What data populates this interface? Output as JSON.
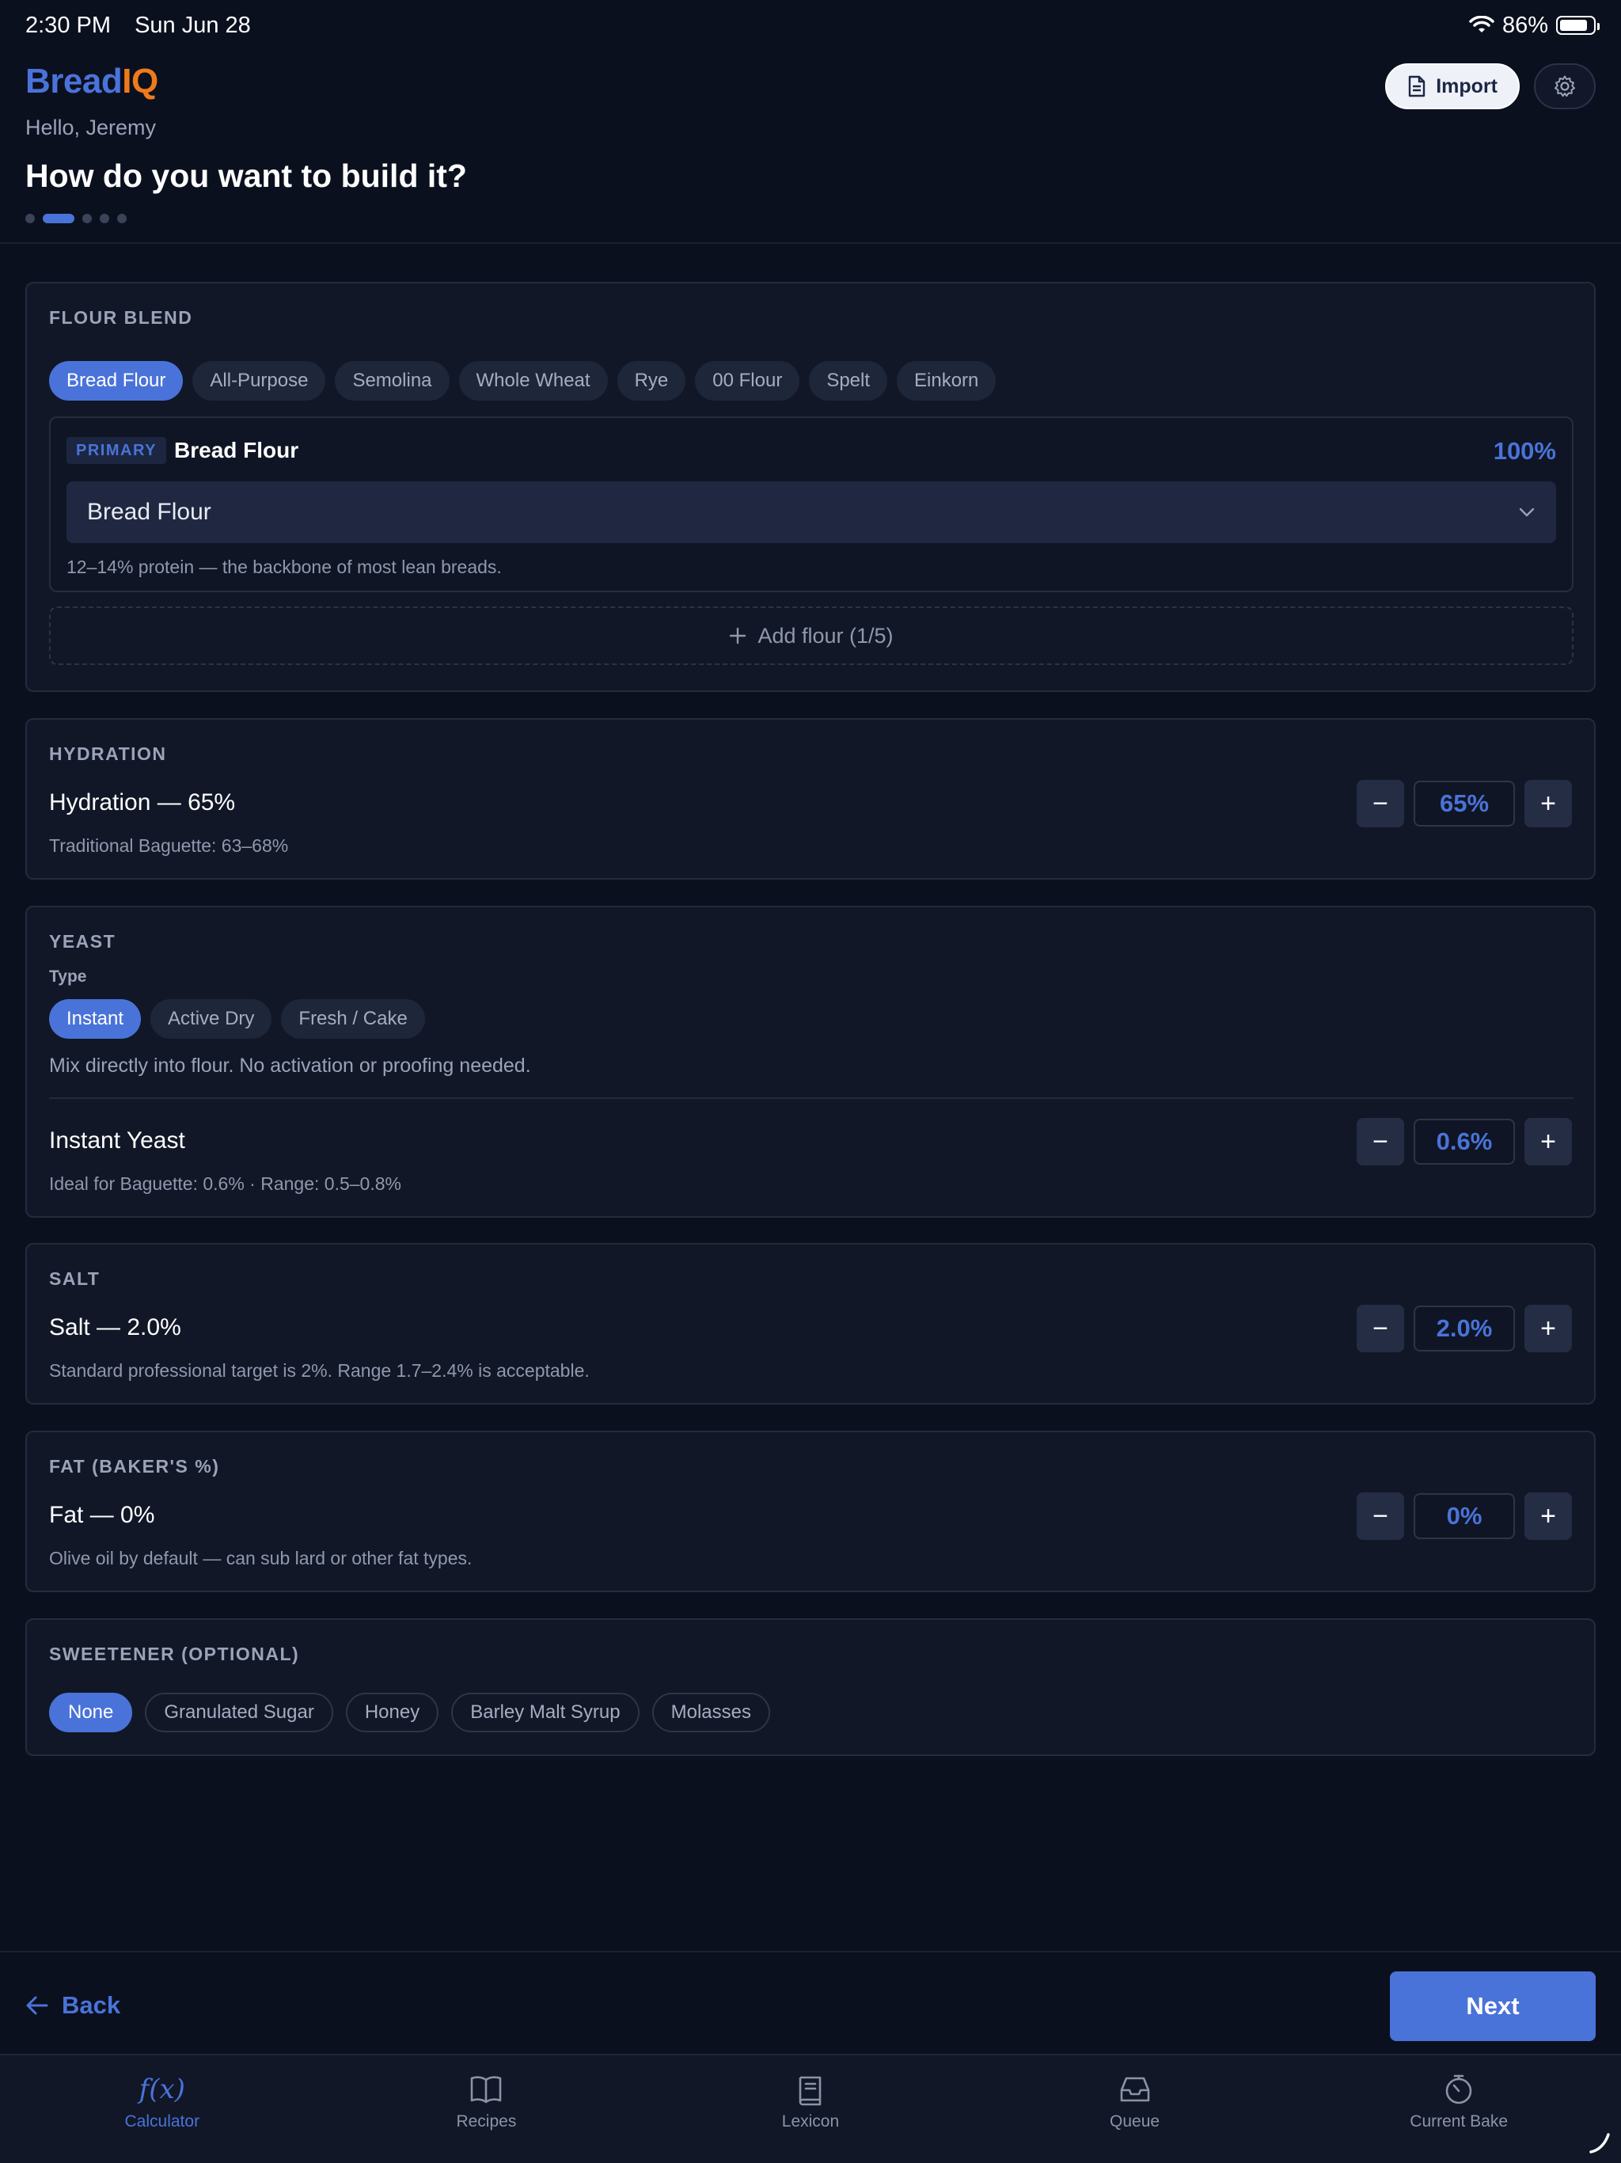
{
  "status": {
    "time": "2:30 PM",
    "date": "Sun Jun 28",
    "battery": "86%",
    "battery_level": 0.86
  },
  "header": {
    "logo_part1": "Bread",
    "logo_part2": "IQ",
    "greeting": "Hello, Jeremy",
    "title": "How do you want to build it?",
    "import_label": "Import",
    "progress": {
      "steps": 5,
      "current": 2
    }
  },
  "flour_blend": {
    "label": "FLOUR BLEND",
    "chips": [
      "Bread Flour",
      "All-Purpose",
      "Semolina",
      "Whole Wheat",
      "Rye",
      "00 Flour",
      "Spelt",
      "Einkorn"
    ],
    "selected_chip": "Bread Flour",
    "primary_badge": "PRIMARY",
    "primary_name": "Bread Flour",
    "primary_pct": "100%",
    "select_value": "Bread Flour",
    "note": "12–14% protein — the backbone of most lean breads.",
    "add_label": "Add flour (1/5)"
  },
  "hydration": {
    "label": "HYDRATION",
    "title": "Hydration — 65%",
    "note": "Traditional Baguette: 63–68%",
    "value": "65%"
  },
  "yeast": {
    "label": "YEAST",
    "type_label": "Type",
    "types": [
      "Instant",
      "Active Dry",
      "Fresh / Cake"
    ],
    "selected_type": "Instant",
    "description": "Mix directly into flour. No activation or proofing needed.",
    "title": "Instant Yeast",
    "note": "Ideal for Baguette: 0.6% · Range: 0.5–0.8%",
    "value": "0.6%"
  },
  "salt": {
    "label": "SALT",
    "title": "Salt — 2.0%",
    "note": "Standard professional target is 2%. Range 1.7–2.4% is acceptable.",
    "value": "2.0%"
  },
  "fat": {
    "label": "FAT (BAKER'S %)",
    "title": "Fat — 0%",
    "note": "Olive oil by default — can sub lard or other fat types.",
    "value": "0%"
  },
  "sweetener": {
    "label": "SWEETENER (OPTIONAL)",
    "options": [
      "None",
      "Granulated Sugar",
      "Honey",
      "Barley Malt Syrup",
      "Molasses"
    ],
    "selected": "None"
  },
  "footer": {
    "back_label": "Back",
    "next_label": "Next"
  },
  "tabs": [
    {
      "label": "Calculator",
      "icon": "function-icon",
      "active": true
    },
    {
      "label": "Recipes",
      "icon": "book-open-icon",
      "active": false
    },
    {
      "label": "Lexicon",
      "icon": "book-icon",
      "active": false
    },
    {
      "label": "Queue",
      "icon": "inbox-icon",
      "active": false
    },
    {
      "label": "Current Bake",
      "icon": "timer-icon",
      "active": false
    }
  ],
  "colors": {
    "accent": "#4a73d9",
    "brand_orange": "#f07a1a",
    "background": "#0b101f"
  }
}
